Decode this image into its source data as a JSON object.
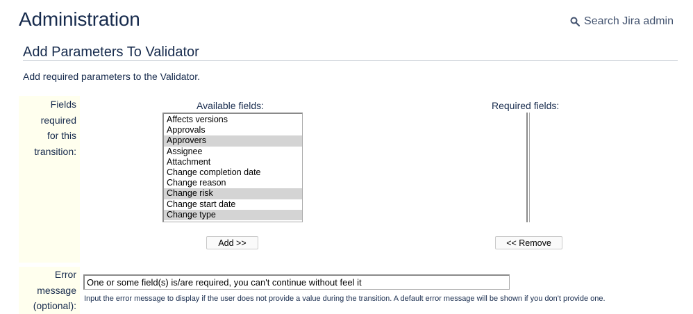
{
  "header": {
    "title": "Administration",
    "search_label": "Search Jira admin",
    "search_icon": "search-icon"
  },
  "section": {
    "title": "Add Parameters To Validator",
    "intro": "Add required parameters to the Validator."
  },
  "form": {
    "fields_label_lines": [
      "Fields",
      "required",
      "for this",
      "transition:"
    ],
    "available_heading": "Available fields:",
    "required_heading": "Required fields:",
    "available_fields": [
      {
        "label": "Affects versions",
        "highlighted": false
      },
      {
        "label": "Approvals",
        "highlighted": false
      },
      {
        "label": "Approvers",
        "highlighted": true
      },
      {
        "label": "Assignee",
        "highlighted": false
      },
      {
        "label": "Attachment",
        "highlighted": false
      },
      {
        "label": "Change completion date",
        "highlighted": false
      },
      {
        "label": "Change reason",
        "highlighted": false
      },
      {
        "label": "Change risk",
        "highlighted": true
      },
      {
        "label": "Change start date",
        "highlighted": false
      },
      {
        "label": "Change type",
        "highlighted": true
      }
    ],
    "required_fields": [],
    "add_button": "Add >>",
    "remove_button": "<< Remove",
    "error_label_lines": [
      "Error",
      "message",
      "(optional):"
    ],
    "error_value": "One or some field(s) is/are required, you can't continue without feel it",
    "error_hint": "Input the error message to display if the user does not provide a value during the transition. A default error message will be shown if you don't provide one."
  }
}
